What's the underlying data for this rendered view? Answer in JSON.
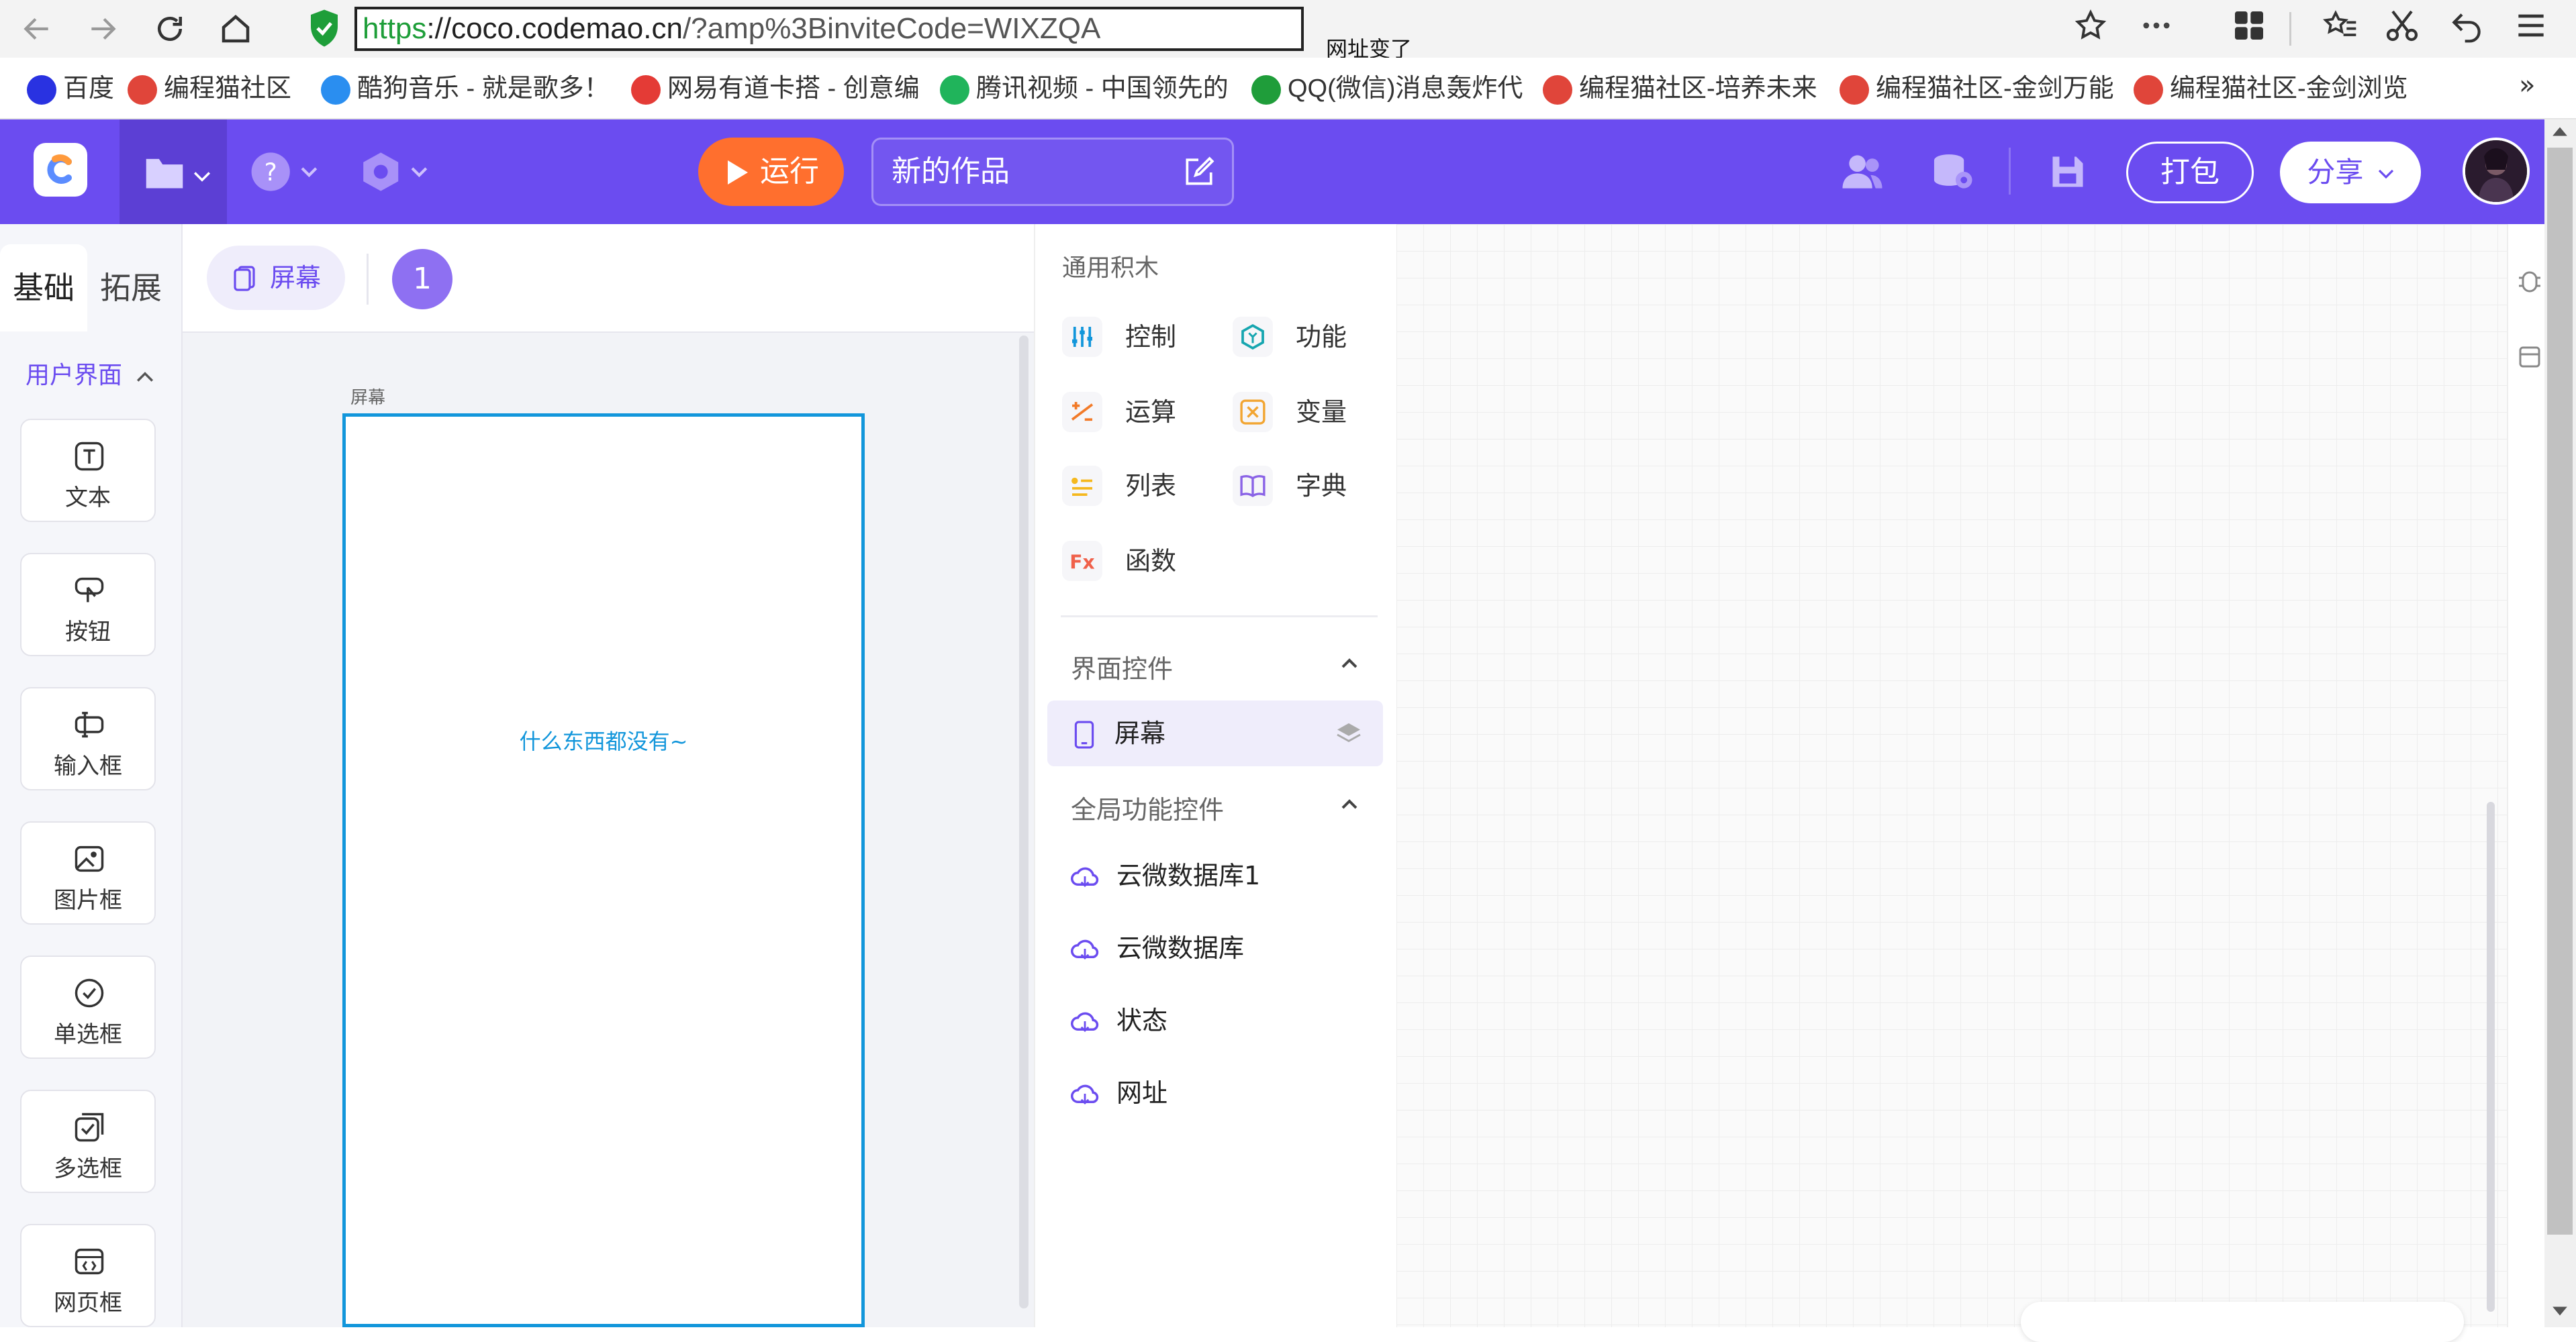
{
  "browser": {
    "url_scheme": "https",
    "url_host": "://coco.codemao.cn",
    "url_rest": "/?amp%3BinviteCode=WIXZQA",
    "tooltip": "网址变了"
  },
  "bookmarks": [
    {
      "label": "百度",
      "icon": "baidu-icon",
      "color": "#2932e1"
    },
    {
      "label": "编程猫社区",
      "icon": "codemao-icon",
      "color": "#e0453a"
    },
    {
      "label": "酷狗音乐 - 就是歌多！",
      "icon": "kugou-icon",
      "color": "#2a8ef0"
    },
    {
      "label": "网易有道卡搭 - 创意编",
      "icon": "youdao-icon",
      "color": "#e43b36"
    },
    {
      "label": "腾讯视频 - 中国领先的",
      "icon": "tencent-video-icon",
      "color": "#20b45b"
    },
    {
      "label": "QQ(微信)消息轰炸代",
      "icon": "n-icon",
      "color": "#1f9d3a"
    },
    {
      "label": "编程猫社区-培养未来",
      "icon": "codemao-icon",
      "color": "#e0453a"
    },
    {
      "label": "编程猫社区-金剑万能",
      "icon": "codemao-icon",
      "color": "#e0453a"
    },
    {
      "label": "编程猫社区-金剑浏览",
      "icon": "codemao-icon",
      "color": "#e0453a"
    }
  ],
  "header": {
    "run_label": "运行",
    "project_title": "新的作品",
    "pack_label": "打包",
    "share_label": "分享",
    "accent": "#6b4cf0",
    "run_color": "#ff6f2e"
  },
  "left_panel": {
    "tabs": [
      "基础",
      "拓展"
    ],
    "section_label": "用户界面",
    "widgets": [
      {
        "label": "文本",
        "icon": "text-icon"
      },
      {
        "label": "按钮",
        "icon": "button-icon"
      },
      {
        "label": "输入框",
        "icon": "input-icon"
      },
      {
        "label": "图片框",
        "icon": "image-icon"
      },
      {
        "label": "单选框",
        "icon": "radio-icon"
      },
      {
        "label": "多选框",
        "icon": "checkbox-icon"
      },
      {
        "label": "网页框",
        "icon": "webview-icon"
      }
    ]
  },
  "screens": {
    "tab_label": "屏幕",
    "count": "1",
    "caption": "屏幕",
    "empty_hint": "什么东西都没有~"
  },
  "blocks": {
    "general_title": "通用积木",
    "categories": [
      {
        "label": "控制",
        "icon": "control-icon",
        "color": "#1296db"
      },
      {
        "label": "功能",
        "icon": "function-icon",
        "color": "#16a6b0"
      },
      {
        "label": "运算",
        "icon": "operator-icon",
        "color": "#f27a28"
      },
      {
        "label": "变量",
        "icon": "variable-icon",
        "color": "#f2a531"
      },
      {
        "label": "列表",
        "icon": "list-icon",
        "color": "#f5b81e"
      },
      {
        "label": "字典",
        "icon": "dictionary-icon",
        "color": "#8a63e6"
      },
      {
        "label": "函数",
        "icon": "fx-icon",
        "color": "#f0604a"
      }
    ],
    "ui_controls_title": "界面控件",
    "screen_item": "屏幕",
    "global_controls_title": "全局功能控件",
    "global_items": [
      "云微数据库1",
      "云微数据库",
      "状态",
      "网址"
    ]
  }
}
